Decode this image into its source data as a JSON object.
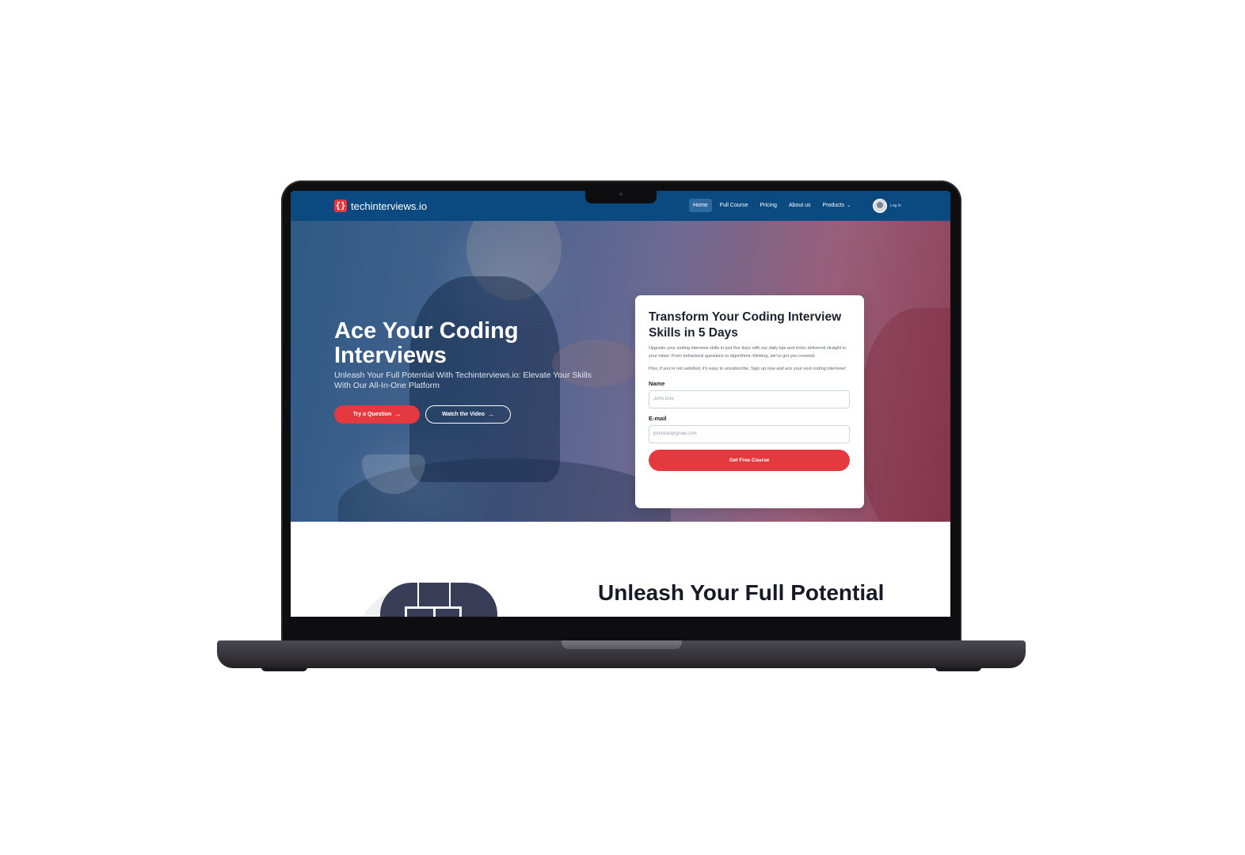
{
  "navbar": {
    "logo_glyph": "{}",
    "brand": "techinterviews.io",
    "links": [
      {
        "label": "Home",
        "active": true
      },
      {
        "label": "Full Course",
        "active": false
      },
      {
        "label": "Pricing",
        "active": false
      },
      {
        "label": "About us",
        "active": false
      },
      {
        "label": "Products",
        "active": false,
        "has_dropdown": true
      }
    ],
    "dropdown_glyph": "⌄",
    "login_label": "Log in"
  },
  "hero": {
    "title": "Ace Your Coding Interviews",
    "subtitle": "Unleash Your Full Potential With Techinterviews.io: Elevate Your Skills With Our All-In-One Platform",
    "primary_button": "Try a Question",
    "secondary_button": "Watch the Video",
    "arrow_glyph": "→"
  },
  "signup_card": {
    "title": "Transform Your Coding Interview Skills in 5 Days",
    "paragraph_1": "Upgrade your coding interview skills in just five days with our daily tips and tricks delivered straight to your inbox. From behavioral questions to algorithmic thinking, we've got you covered.",
    "paragraph_2": "Plus, if you're not satisfied, it's easy to unsubscribe. Sign up now and ace your next coding interview!",
    "name_label": "Name",
    "name_placeholder": "John Doe",
    "email_label": "E-mail",
    "email_placeholder": "johndoe@gmail.com",
    "submit_label": "Get Free Course"
  },
  "section": {
    "title": "Unleash Your Full Potential"
  },
  "colors": {
    "navbar": "#0a4a80",
    "accent": "#e4393f",
    "laptop_frame": "#0e0e10"
  }
}
